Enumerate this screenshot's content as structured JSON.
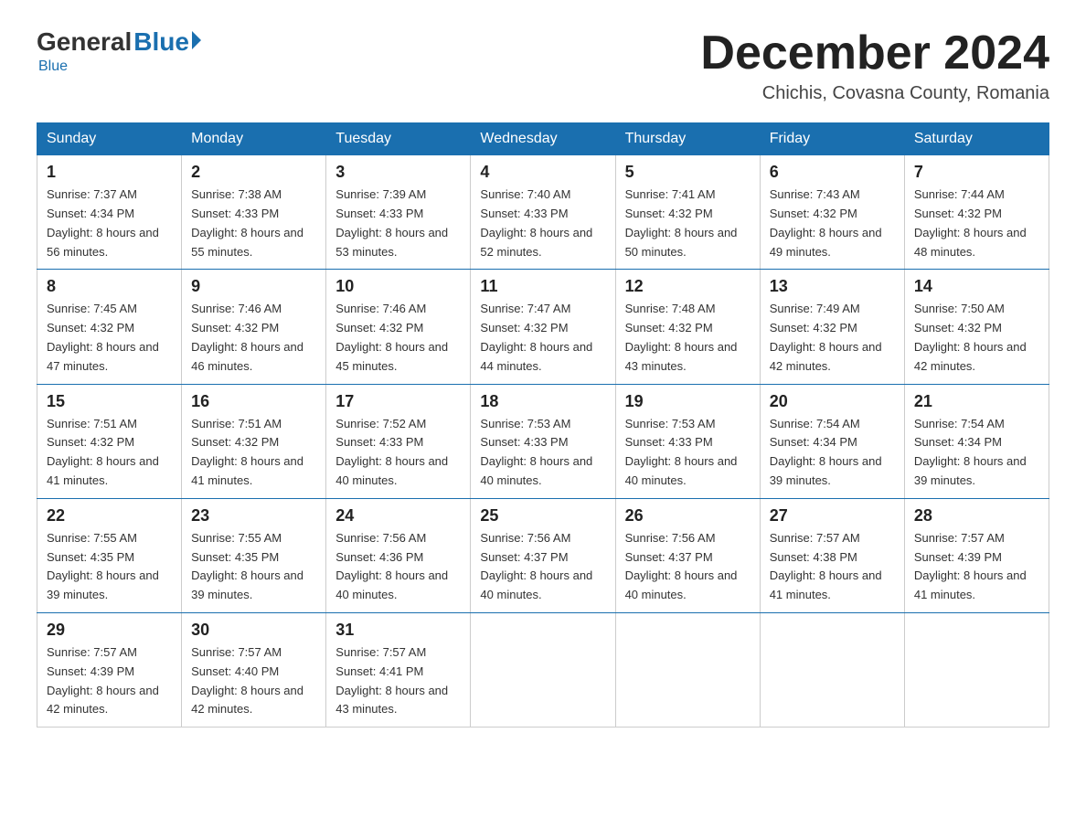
{
  "logo": {
    "general": "General",
    "blue": "Blue",
    "subtitle": "Blue"
  },
  "header": {
    "month": "December 2024",
    "location": "Chichis, Covasna County, Romania"
  },
  "days_of_week": [
    "Sunday",
    "Monday",
    "Tuesday",
    "Wednesday",
    "Thursday",
    "Friday",
    "Saturday"
  ],
  "weeks": [
    [
      {
        "day": "1",
        "sunrise": "7:37 AM",
        "sunset": "4:34 PM",
        "daylight": "8 hours and 56 minutes."
      },
      {
        "day": "2",
        "sunrise": "7:38 AM",
        "sunset": "4:33 PM",
        "daylight": "8 hours and 55 minutes."
      },
      {
        "day": "3",
        "sunrise": "7:39 AM",
        "sunset": "4:33 PM",
        "daylight": "8 hours and 53 minutes."
      },
      {
        "day": "4",
        "sunrise": "7:40 AM",
        "sunset": "4:33 PM",
        "daylight": "8 hours and 52 minutes."
      },
      {
        "day": "5",
        "sunrise": "7:41 AM",
        "sunset": "4:32 PM",
        "daylight": "8 hours and 50 minutes."
      },
      {
        "day": "6",
        "sunrise": "7:43 AM",
        "sunset": "4:32 PM",
        "daylight": "8 hours and 49 minutes."
      },
      {
        "day": "7",
        "sunrise": "7:44 AM",
        "sunset": "4:32 PM",
        "daylight": "8 hours and 48 minutes."
      }
    ],
    [
      {
        "day": "8",
        "sunrise": "7:45 AM",
        "sunset": "4:32 PM",
        "daylight": "8 hours and 47 minutes."
      },
      {
        "day": "9",
        "sunrise": "7:46 AM",
        "sunset": "4:32 PM",
        "daylight": "8 hours and 46 minutes."
      },
      {
        "day": "10",
        "sunrise": "7:46 AM",
        "sunset": "4:32 PM",
        "daylight": "8 hours and 45 minutes."
      },
      {
        "day": "11",
        "sunrise": "7:47 AM",
        "sunset": "4:32 PM",
        "daylight": "8 hours and 44 minutes."
      },
      {
        "day": "12",
        "sunrise": "7:48 AM",
        "sunset": "4:32 PM",
        "daylight": "8 hours and 43 minutes."
      },
      {
        "day": "13",
        "sunrise": "7:49 AM",
        "sunset": "4:32 PM",
        "daylight": "8 hours and 42 minutes."
      },
      {
        "day": "14",
        "sunrise": "7:50 AM",
        "sunset": "4:32 PM",
        "daylight": "8 hours and 42 minutes."
      }
    ],
    [
      {
        "day": "15",
        "sunrise": "7:51 AM",
        "sunset": "4:32 PM",
        "daylight": "8 hours and 41 minutes."
      },
      {
        "day": "16",
        "sunrise": "7:51 AM",
        "sunset": "4:32 PM",
        "daylight": "8 hours and 41 minutes."
      },
      {
        "day": "17",
        "sunrise": "7:52 AM",
        "sunset": "4:33 PM",
        "daylight": "8 hours and 40 minutes."
      },
      {
        "day": "18",
        "sunrise": "7:53 AM",
        "sunset": "4:33 PM",
        "daylight": "8 hours and 40 minutes."
      },
      {
        "day": "19",
        "sunrise": "7:53 AM",
        "sunset": "4:33 PM",
        "daylight": "8 hours and 40 minutes."
      },
      {
        "day": "20",
        "sunrise": "7:54 AM",
        "sunset": "4:34 PM",
        "daylight": "8 hours and 39 minutes."
      },
      {
        "day": "21",
        "sunrise": "7:54 AM",
        "sunset": "4:34 PM",
        "daylight": "8 hours and 39 minutes."
      }
    ],
    [
      {
        "day": "22",
        "sunrise": "7:55 AM",
        "sunset": "4:35 PM",
        "daylight": "8 hours and 39 minutes."
      },
      {
        "day": "23",
        "sunrise": "7:55 AM",
        "sunset": "4:35 PM",
        "daylight": "8 hours and 39 minutes."
      },
      {
        "day": "24",
        "sunrise": "7:56 AM",
        "sunset": "4:36 PM",
        "daylight": "8 hours and 40 minutes."
      },
      {
        "day": "25",
        "sunrise": "7:56 AM",
        "sunset": "4:37 PM",
        "daylight": "8 hours and 40 minutes."
      },
      {
        "day": "26",
        "sunrise": "7:56 AM",
        "sunset": "4:37 PM",
        "daylight": "8 hours and 40 minutes."
      },
      {
        "day": "27",
        "sunrise": "7:57 AM",
        "sunset": "4:38 PM",
        "daylight": "8 hours and 41 minutes."
      },
      {
        "day": "28",
        "sunrise": "7:57 AM",
        "sunset": "4:39 PM",
        "daylight": "8 hours and 41 minutes."
      }
    ],
    [
      {
        "day": "29",
        "sunrise": "7:57 AM",
        "sunset": "4:39 PM",
        "daylight": "8 hours and 42 minutes."
      },
      {
        "day": "30",
        "sunrise": "7:57 AM",
        "sunset": "4:40 PM",
        "daylight": "8 hours and 42 minutes."
      },
      {
        "day": "31",
        "sunrise": "7:57 AM",
        "sunset": "4:41 PM",
        "daylight": "8 hours and 43 minutes."
      },
      null,
      null,
      null,
      null
    ]
  ]
}
